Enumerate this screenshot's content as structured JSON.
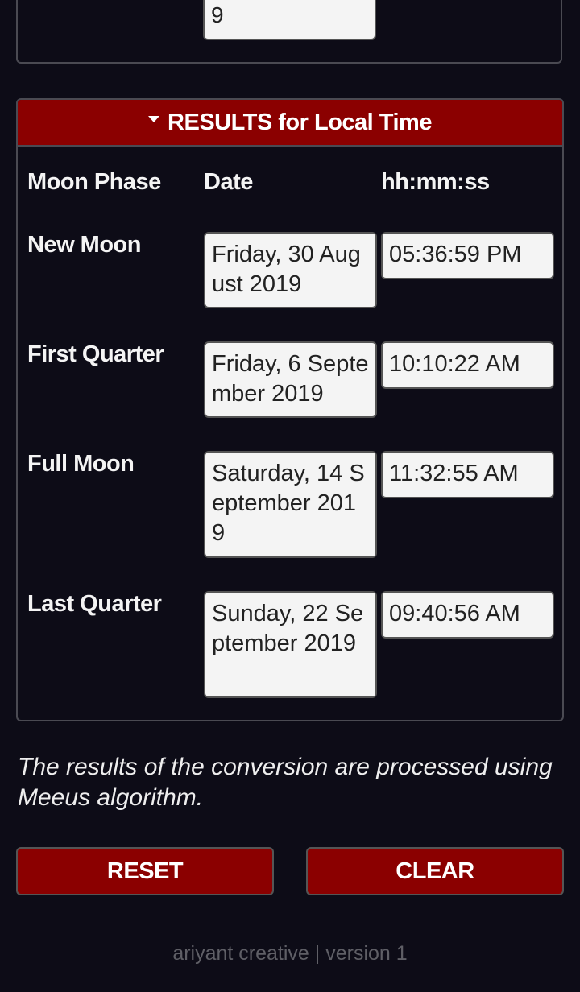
{
  "top_panel": {
    "field_value_tail": "9"
  },
  "results": {
    "header_title": "RESULTS for Local Time",
    "header_icon": "caret-down-icon",
    "columns": {
      "phase": "Moon Phase",
      "date": "Date",
      "time": "hh:mm:ss"
    },
    "rows": [
      {
        "phase": "New Moon",
        "date": "Friday, 30 August 2019",
        "time": "05:36:59 PM"
      },
      {
        "phase": "First Quarter",
        "date": "Friday, 6 September 2019",
        "time": "10:10:22 AM"
      },
      {
        "phase": "Full Moon",
        "date": "Saturday, 14 September 2019",
        "time": "11:32:55 AM"
      },
      {
        "phase": "Last Quarter",
        "date": "Sunday, 22 September 2019",
        "time": "09:40:56 AM"
      }
    ]
  },
  "note": "The results of the conversion are processed using Meeus algorithm.",
  "buttons": {
    "reset": "RESET",
    "clear": "CLEAR"
  },
  "footer": "ariyant creative | version 1",
  "colors": {
    "background": "#0d0c17",
    "accent": "#8b0000",
    "field_bg": "#f4f4f4",
    "border": "#4a4a52",
    "footer_text": "#5f5f66"
  }
}
